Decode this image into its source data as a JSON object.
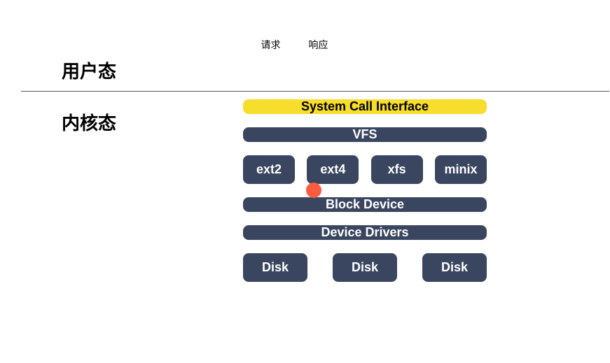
{
  "topLabels": {
    "request": "请求",
    "response": "响应"
  },
  "sections": {
    "user": "用户态",
    "kernel": "内核态"
  },
  "layers": {
    "syscall": "System Call Interface",
    "vfs": "VFS",
    "fs": {
      "ext2": "ext2",
      "ext4": "ext4",
      "xfs": "xfs",
      "minix": "minix"
    },
    "block": "Block Device",
    "drivers": "Device Drivers",
    "disks": {
      "d1": "Disk",
      "d2": "Disk",
      "d3": "Disk"
    }
  },
  "colors": {
    "accent_yellow": "#f7dd2c",
    "box_bg": "#3a4660",
    "marker": "#fc5b3f"
  }
}
